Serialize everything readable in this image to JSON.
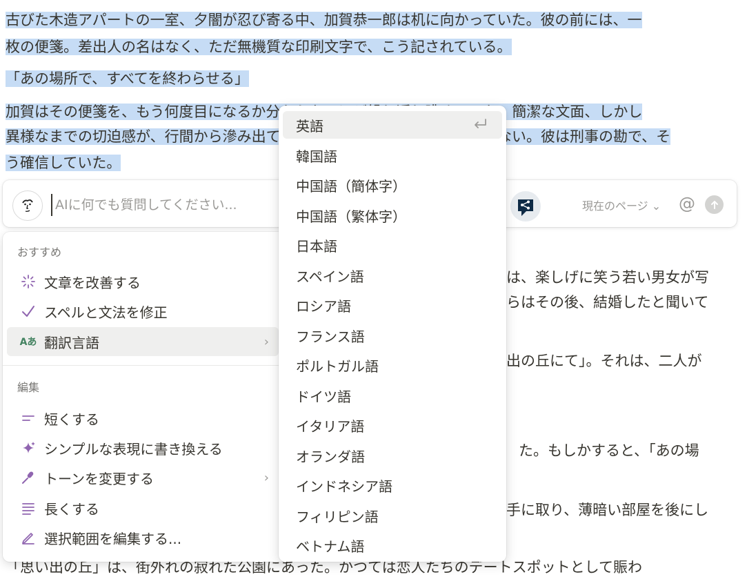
{
  "document": {
    "lines": [
      {
        "text": "古びた木造アパートの一室、夕闇が忍び寄る中、加賀恭一郎は机に向かっていた。彼の前には、一"
      },
      {
        "text": "枚の便箋。差出人の名はなく、ただ無機質な印刷文字で、こう記されている。"
      },
      {
        "text": "「あの場所で、すべてを終わらせる」"
      },
      {
        "text": "加賀はその便箋を、もう何度目になるか分からないほど繰り返し眺めていた。簡潔な文面、しかし"
      },
      {
        "text": "異様なまでの切迫感が、行間から滲み出ている。これは単なるいたずらではない。彼は刑事の勘で、そ"
      },
      {
        "text": "う確信していた。"
      },
      {
        "text": "は、楽しげに笑う若い男女が写"
      },
      {
        "text": "らはその後、結婚したと聞いて"
      },
      {
        "text": "出の丘にて」。それは、二人が"
      },
      {
        "text": "た。もしかすると、「あの場"
      },
      {
        "text": "手に取り、薄暗い部屋を後にし"
      },
      {
        "text": "「思い出の丘」は、街外れの寂れた公園にあった。かつては恋人たちのデートスポットとして賑わ"
      }
    ]
  },
  "ai_bar": {
    "placeholder": "AIに何でも質問してください...",
    "scope_label": "現在のページ ⌄",
    "mention_icon": "at-icon",
    "send_icon": "arrow-up-icon"
  },
  "ai_menu": {
    "suggested_label": "おすすめ",
    "edit_label": "編集",
    "suggested": [
      {
        "label": "文章を改善する",
        "icon": "sparkle-burst-icon"
      },
      {
        "label": "スペルと文法を修正",
        "icon": "check-icon"
      },
      {
        "label": "翻訳言語",
        "icon": "translate-icon",
        "icon_text": "Aあ",
        "submenu": true
      }
    ],
    "edit": [
      {
        "label": "短くする",
        "icon": "shorten-lines-icon"
      },
      {
        "label": "シンプルな表現に書き換える",
        "icon": "sparkles-icon"
      },
      {
        "label": "トーンを変更する",
        "icon": "microphone-icon",
        "submenu": true
      },
      {
        "label": "長くする",
        "icon": "lengthen-lines-icon"
      },
      {
        "label": "選択範囲を編集する...",
        "icon": "pen-icon"
      }
    ]
  },
  "language_menu": {
    "items": [
      "英語",
      "韓国語",
      "中国語（簡体字）",
      "中国語（繁体字）",
      "日本語",
      "スペイン語",
      "ロシア語",
      "フランス語",
      "ポルトガル語",
      "ドイツ語",
      "イタリア語",
      "オランダ語",
      "インドネシア語",
      "フィリピン語",
      "ベトナム語"
    ],
    "selected": "英語"
  },
  "colors": {
    "highlight": "#c6dcf5",
    "icon_purple": "#9065b0",
    "translate_green": "#448361",
    "deepl_navy": "#0f2b46"
  }
}
